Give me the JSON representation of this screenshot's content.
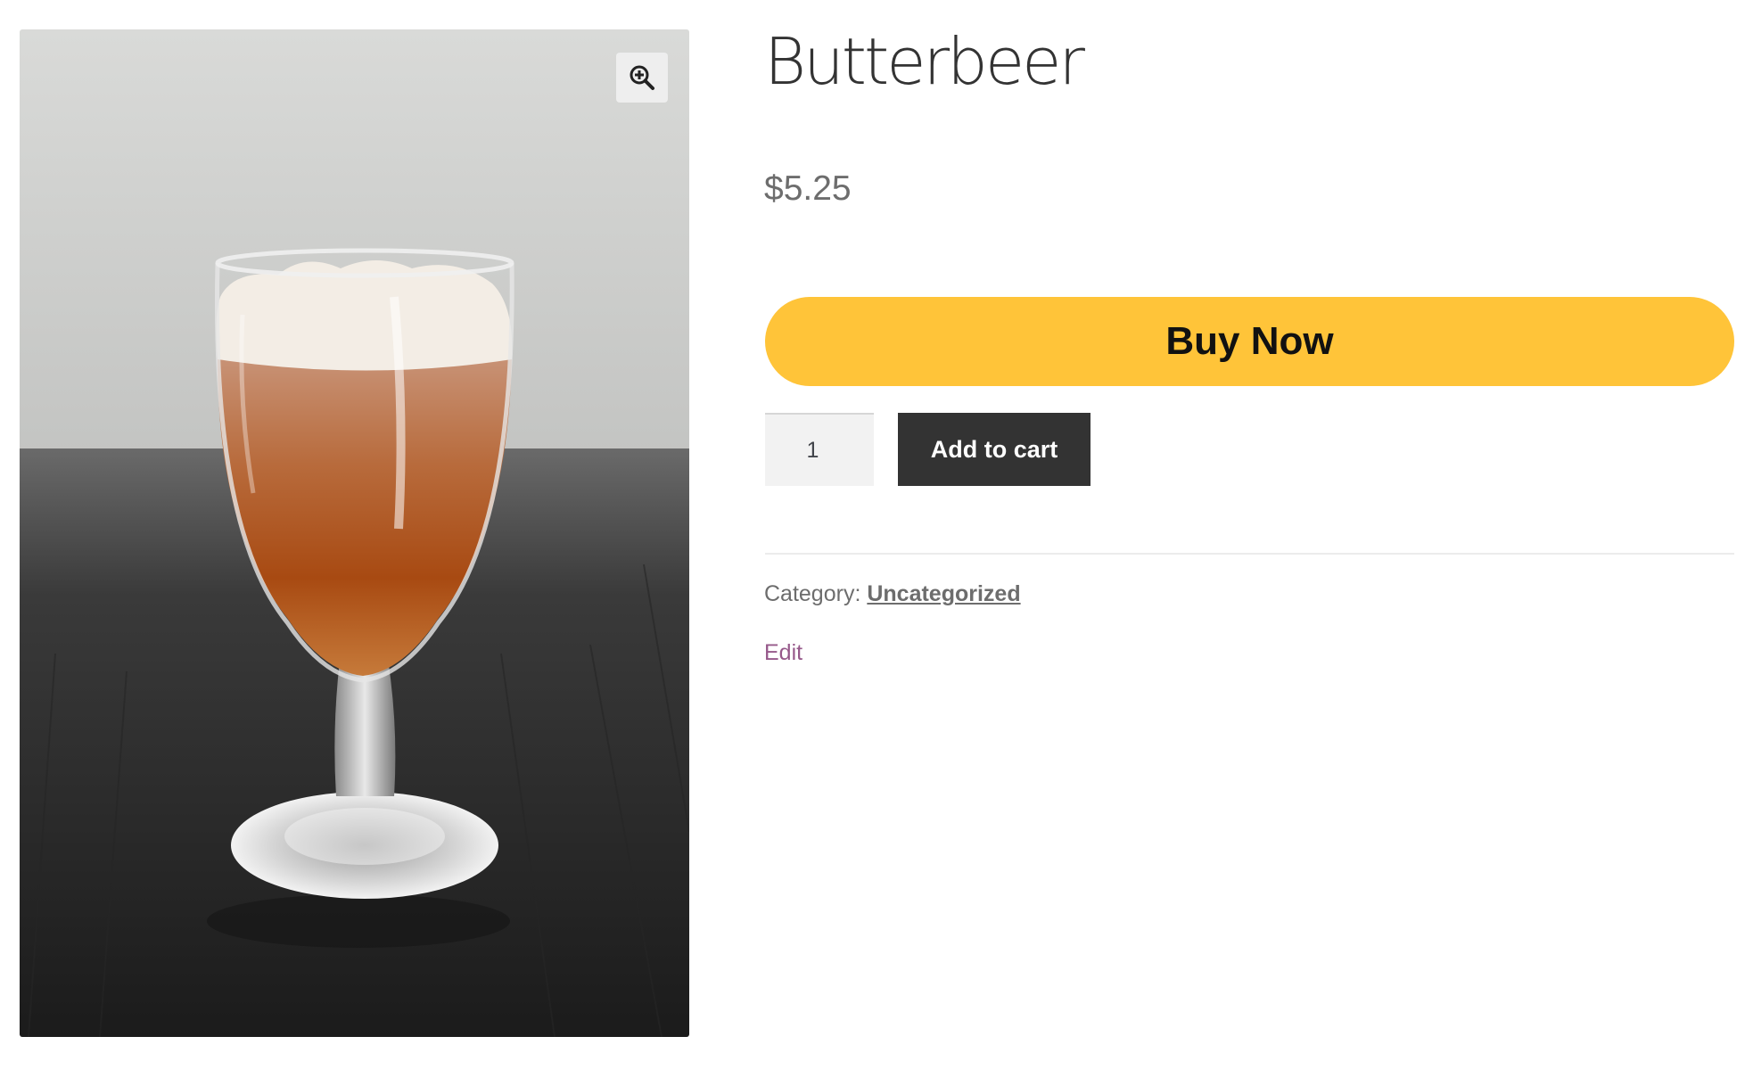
{
  "product": {
    "title": "Butterbeer",
    "price": "$5.25",
    "image_alt": "Butterbeer in a stemmed glass"
  },
  "gallery": {
    "zoom_icon": "zoom-in-icon"
  },
  "purchase": {
    "buy_now_label": "Buy Now",
    "buy_now_color": "#ffc439",
    "quantity_value": "1",
    "add_to_cart_label": "Add to cart"
  },
  "meta": {
    "category_label": "Category:",
    "category_value": "Uncategorized",
    "edit_label": "Edit"
  }
}
